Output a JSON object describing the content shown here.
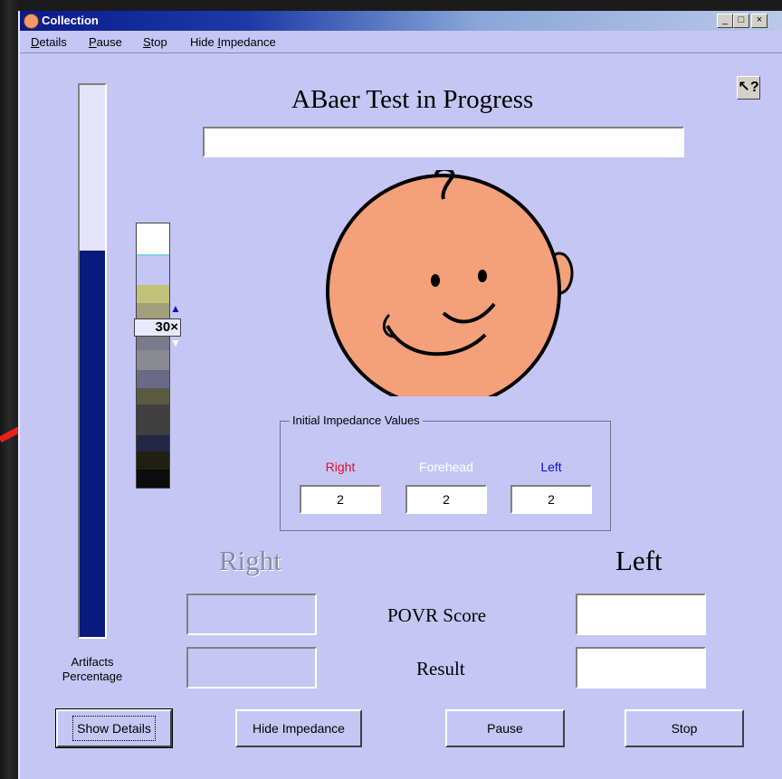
{
  "window": {
    "title": "Collection",
    "controls": {
      "minimize": "_",
      "maximize": "□",
      "close": "×"
    }
  },
  "menu": [
    {
      "label": "Details",
      "mnemonic": "D"
    },
    {
      "label": "Pause",
      "mnemonic": "P"
    },
    {
      "label": "Stop",
      "mnemonic": "S"
    },
    {
      "label": "Hide Impedance",
      "mnemonic": "I"
    }
  ],
  "header": {
    "title": "ABaer Test in Progress",
    "help_icon": "question-pointer-icon"
  },
  "status_field": {
    "value": ""
  },
  "artifacts": {
    "label_line1": "Artifacts",
    "label_line2": "Percentage",
    "level_fraction": 0.7,
    "fill_color": "#0a1a7c"
  },
  "gain": {
    "value": "30",
    "suffix": "×"
  },
  "impedance": {
    "legend": "Initial Impedance Values",
    "columns": [
      {
        "label": "Right",
        "value": "2",
        "color": "#e0102a"
      },
      {
        "label": "Forehead",
        "value": "2",
        "color": "#ffffff"
      },
      {
        "label": "Left",
        "value": "2",
        "color": "#1010d0"
      }
    ]
  },
  "results": {
    "right_heading": "Right",
    "left_heading": "Left",
    "povr_label": "POVR Score",
    "result_label": "Result",
    "right_povr": "",
    "left_povr": "",
    "right_result": "",
    "left_result": ""
  },
  "buttons": {
    "show_details": "Show Details",
    "hide_impedance": "Hide Impedance",
    "pause": "Pause",
    "stop": "Stop"
  },
  "colors": {
    "window_bg": "#c6c6f4",
    "face": "#f4a07a",
    "pointer_arrow": "#e8201a"
  }
}
